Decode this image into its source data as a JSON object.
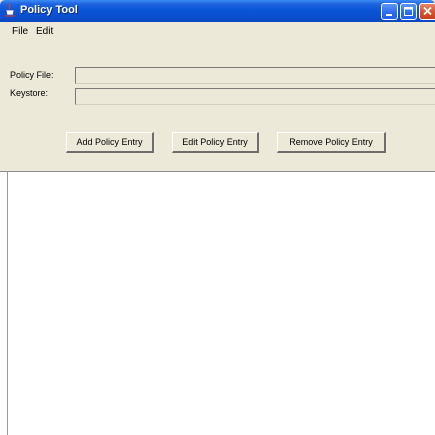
{
  "window": {
    "title": "Policy Tool",
    "icon": "java-cup-icon"
  },
  "titlebar_buttons": {
    "minimize_icon": "minimize-icon",
    "maximize_icon": "maximize-icon",
    "close_icon": "close-icon"
  },
  "menubar": {
    "items": [
      {
        "label": "File"
      },
      {
        "label": "Edit"
      }
    ]
  },
  "form": {
    "policy_file": {
      "label": "Policy File:",
      "value": ""
    },
    "keystore": {
      "label": "Keystore:",
      "value": ""
    }
  },
  "buttons": {
    "add": "Add Policy Entry",
    "edit": "Edit Policy Entry",
    "remove": "Remove Policy Entry"
  },
  "policy_entries": [],
  "colors": {
    "titlebar": "#0a4fd0",
    "close_button": "#d44f2b",
    "window_bg": "#ece9d8",
    "list_bg": "#ffffff"
  }
}
